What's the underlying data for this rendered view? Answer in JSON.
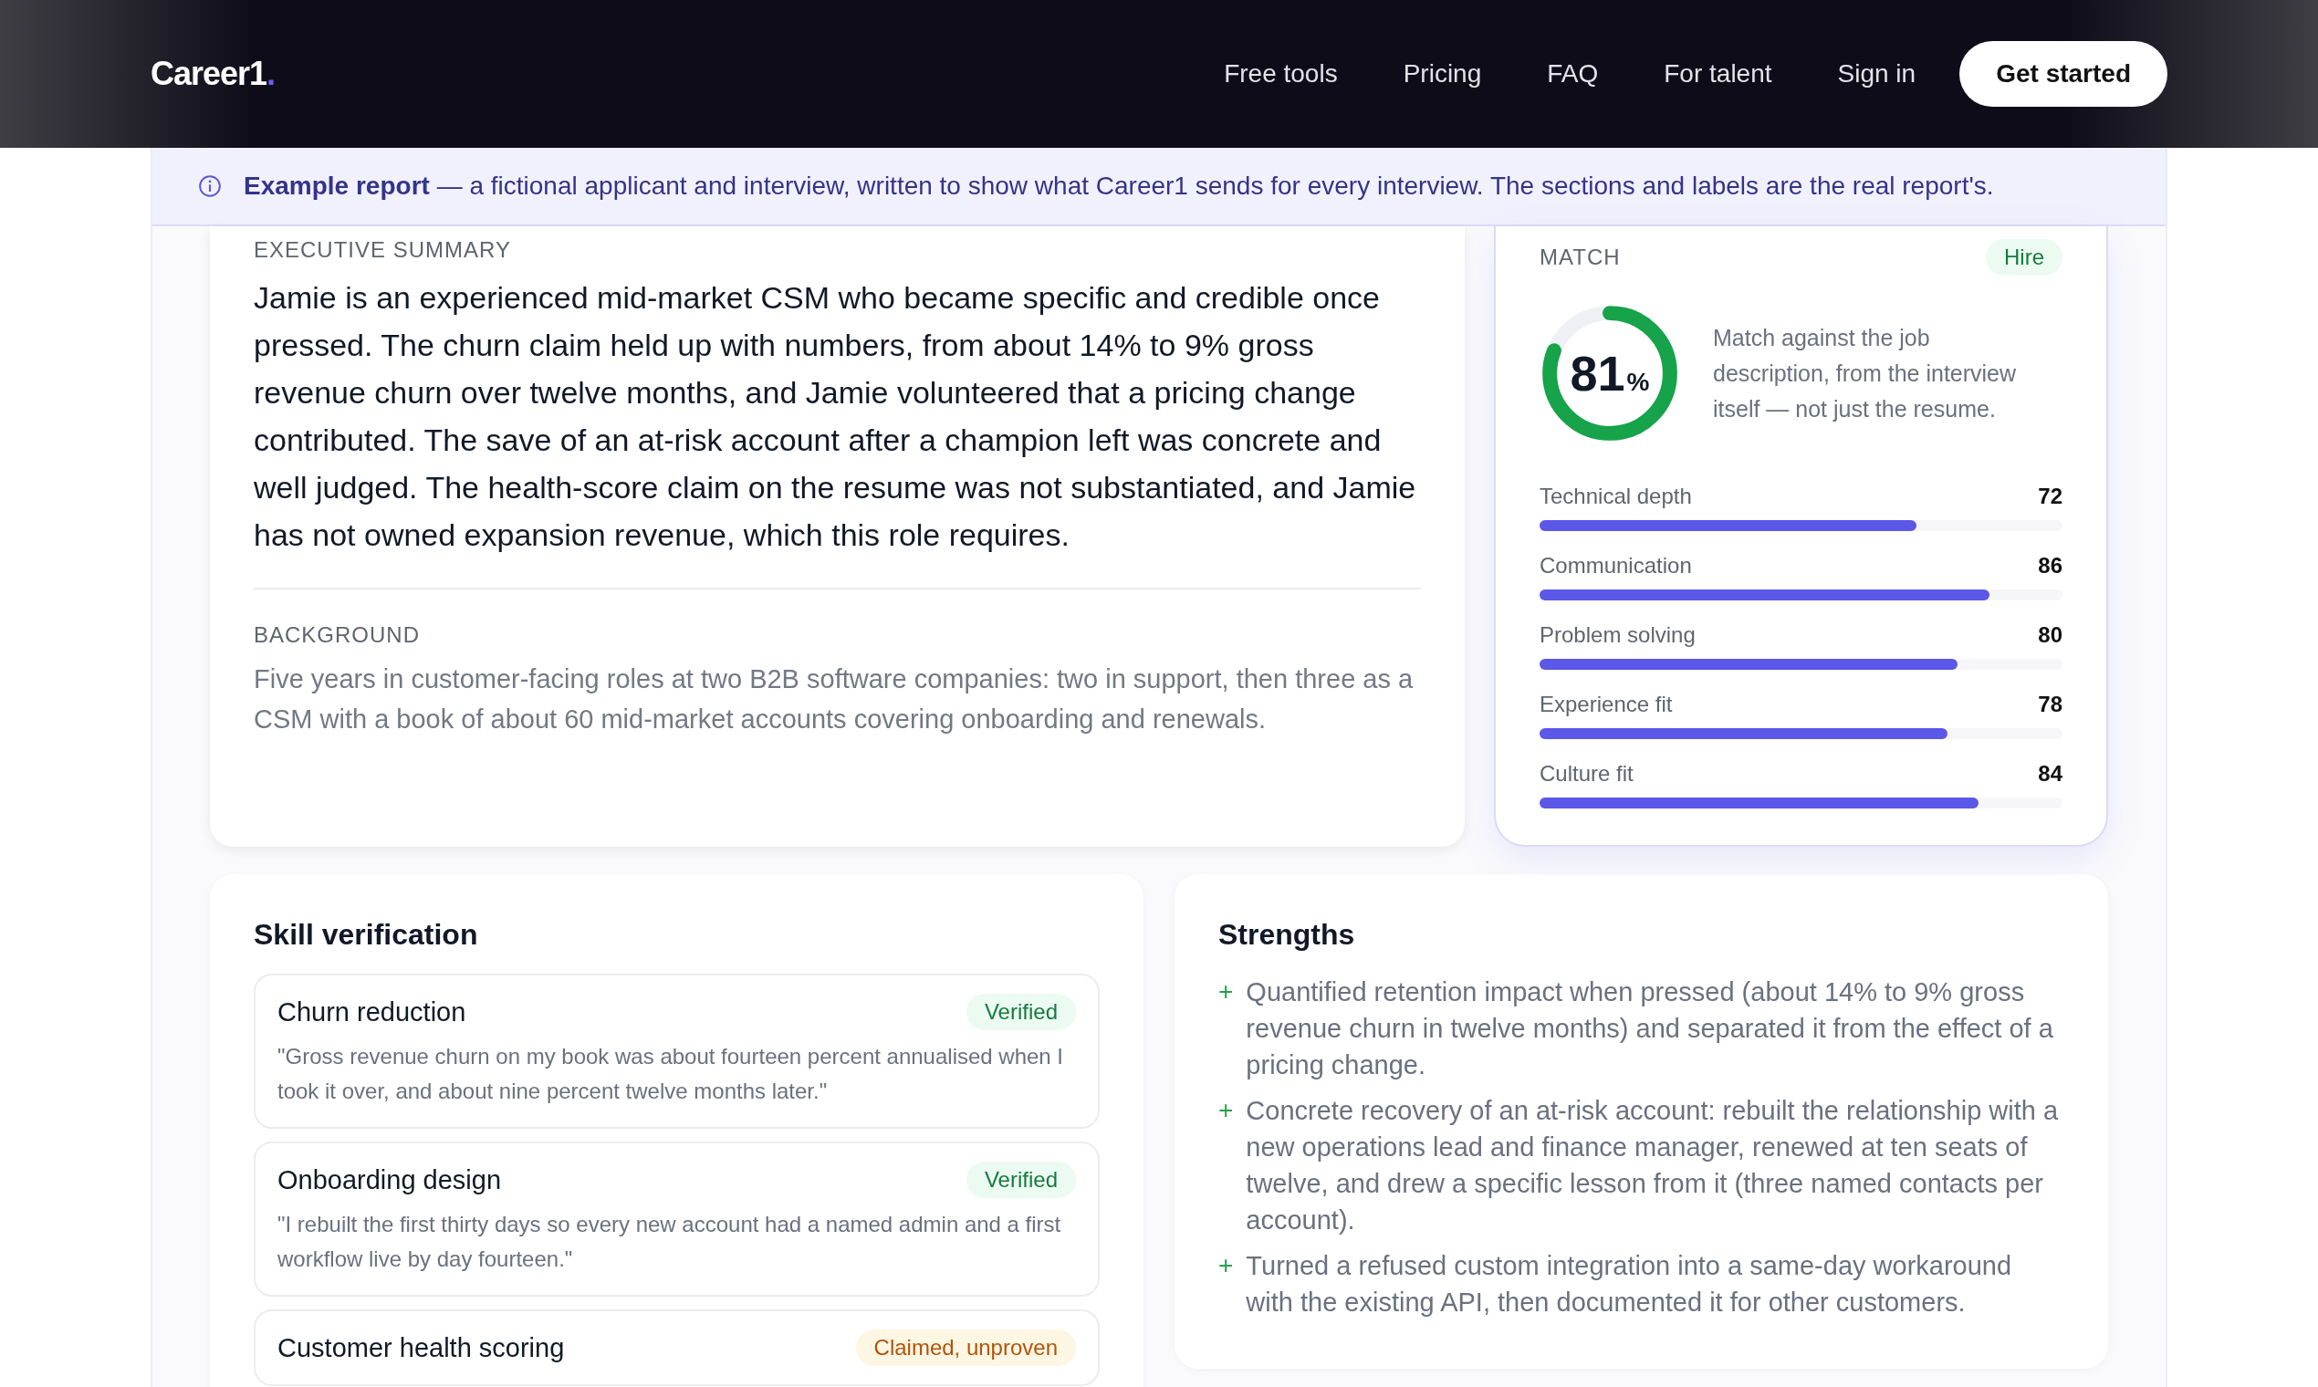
{
  "header": {
    "logo": {
      "name": "Career1",
      "mark": "."
    },
    "nav": [
      {
        "label": "Free tools"
      },
      {
        "label": "Pricing"
      },
      {
        "label": "FAQ"
      },
      {
        "label": "For talent"
      },
      {
        "label": "Sign in"
      }
    ],
    "cta": "Get started"
  },
  "banner": {
    "text": "**Example report** — a fictional applicant and interview, written to show what Career1 sends for every interview. The sections and labels are the real report's."
  },
  "summary": {
    "sections": [
      {
        "label": "EXECUTIVE SUMMARY",
        "kind": "lead",
        "text": "Jamie is an experienced mid-market CSM who became specific and credible once pressed. The churn claim held up with numbers, from about 14% to 9% gross revenue churn over twelve months, and Jamie volunteered that a pricing change contributed. The save of an at-risk account after a champion left was concrete and well judged. The health-score claim on the resume was not substantiated, and Jamie has not owned expansion revenue, which this role requires."
      },
      {
        "label": "BACKGROUND",
        "kind": "plain",
        "text": "Five years in customer-facing roles at two B2B software companies: two in support, then three as a CSM with a book of about 60 mid-market accounts covering onboarding and renewals."
      }
    ]
  },
  "match": {
    "label": "MATCH",
    "verdict": "Hire",
    "score": "81",
    "unit": "%",
    "level": 0.81,
    "note": "Match against the job description, from the interview itself — not just the resume.",
    "metrics": [
      {
        "name": "Technical depth",
        "value": "72",
        "level": 0.72
      },
      {
        "name": "Communication",
        "value": "86",
        "level": 0.86
      },
      {
        "name": "Problem solving",
        "value": "80",
        "level": 0.8
      },
      {
        "name": "Experience fit",
        "value": "78",
        "level": 0.78
      },
      {
        "name": "Culture fit",
        "value": "84",
        "level": 0.84
      }
    ]
  },
  "skills": {
    "title": "Skill verification",
    "items": [
      {
        "name": "Churn reduction",
        "status": "Verified",
        "kind": "verified",
        "quote": "\"Gross revenue churn on my book was about fourteen percent annualised when I took it over, and about nine percent twelve months later.\""
      },
      {
        "name": "Onboarding design",
        "status": "Verified",
        "kind": "verified",
        "quote": "\"I rebuilt the first thirty days so every new account had a named admin and a first workflow live by day fourteen.\""
      },
      {
        "name": "Customer health scoring",
        "status": "Claimed, unproven",
        "kind": "unproven"
      }
    ]
  },
  "strengths": {
    "title": "Strengths",
    "marker": "+",
    "items": [
      "Quantified retention impact when pressed (about 14% to 9% gross revenue churn in twelve months) and separated it from the effect of a pricing change.",
      "Concrete recovery of an at-risk account: rebuilt the relationship with a new operations lead and finance manager, renewed at ten seats of twelve, and drew a specific lesson from it (three named contacts per account).",
      "Turned a refused custom integration into a same-day workaround with the existing API, then documented it for other customers."
    ]
  }
}
